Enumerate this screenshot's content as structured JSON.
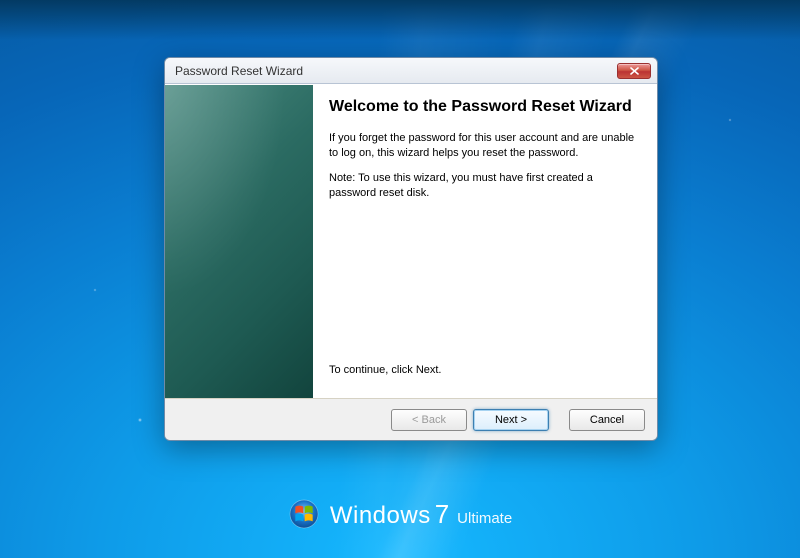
{
  "window": {
    "title": "Password Reset Wizard"
  },
  "content": {
    "heading": "Welcome to the Password Reset Wizard",
    "para1": "If you forget the password for this user account and are unable to log on, this wizard helps you reset the password.",
    "para2": "Note: To use this wizard, you must have first created a password reset disk.",
    "continue": "To continue, click Next."
  },
  "buttons": {
    "back": "< Back",
    "next": "Next >",
    "cancel": "Cancel"
  },
  "branding": {
    "windows": "Windows",
    "seven": "7",
    "edition": "Ultimate"
  }
}
